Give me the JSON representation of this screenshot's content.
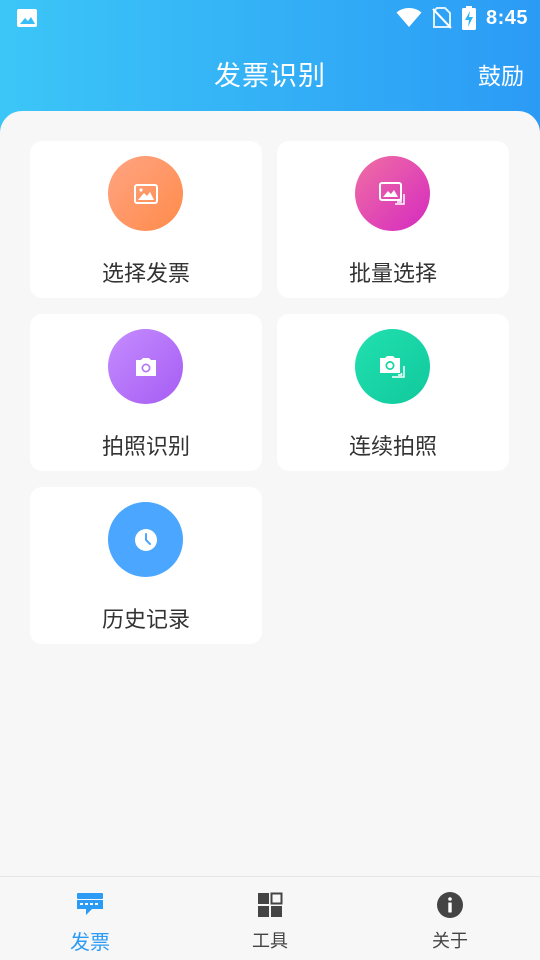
{
  "status_bar": {
    "time": "8:45",
    "icons": [
      "image-icon",
      "wifi-icon",
      "no-sim-icon",
      "battery-charging-icon"
    ]
  },
  "app_bar": {
    "title": "发票识别",
    "action": "鼓励"
  },
  "cards": [
    {
      "label": "选择发票",
      "icon": "image-icon",
      "color": "#ff9a6a"
    },
    {
      "label": "批量选择",
      "icon": "images-icon",
      "color": "#e04cb2"
    },
    {
      "label": "拍照识别",
      "icon": "camera-icon",
      "color": "#b579fa"
    },
    {
      "label": "连续拍照",
      "icon": "camera-multiple-icon",
      "color": "#16d3a5"
    },
    {
      "label": "历史记录",
      "icon": "clock-icon",
      "color": "#4aa6ff"
    }
  ],
  "bottom_nav": {
    "items": [
      {
        "label": "发票",
        "icon": "invoice-icon",
        "active": true
      },
      {
        "label": "工具",
        "icon": "grid-icon",
        "active": false
      },
      {
        "label": "关于",
        "icon": "info-icon",
        "active": false
      }
    ],
    "active_color": "#2b9bf6"
  }
}
